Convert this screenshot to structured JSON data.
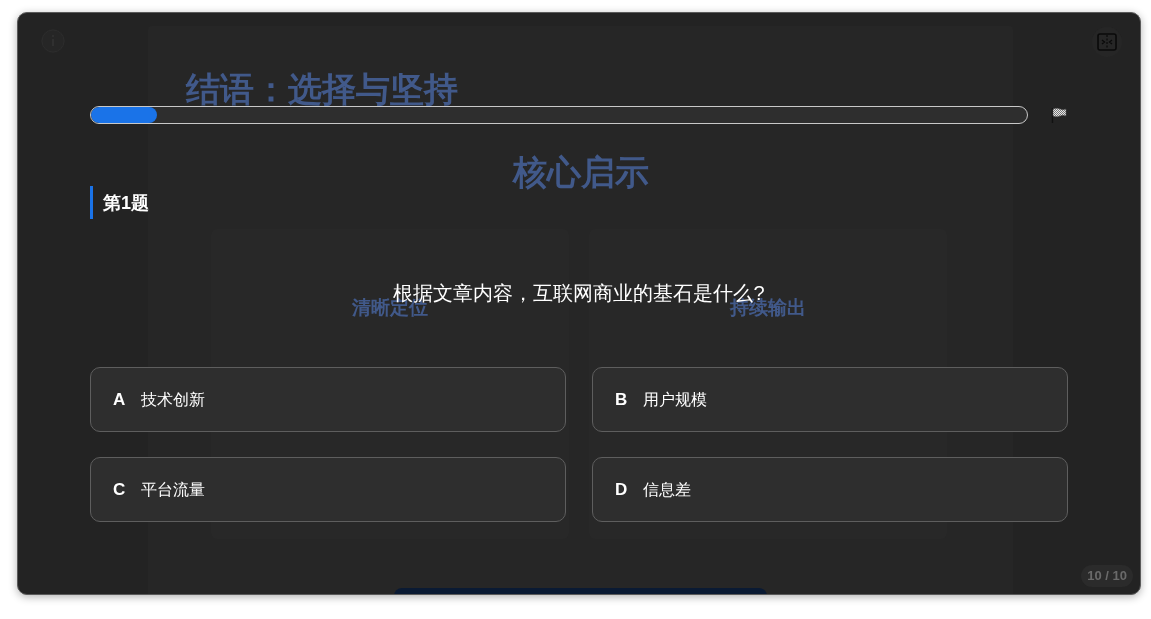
{
  "background_slide": {
    "title": "结语：选择与坚持",
    "heading": "核心启示",
    "cards": [
      "清晰定位",
      "持续输出"
    ],
    "page_counter": "10 / 10"
  },
  "progress": {
    "level": 0.07
  },
  "question": {
    "label": "第1题",
    "text": "根据文章内容，互联网商业的基石是什么?"
  },
  "options": [
    {
      "letter": "A",
      "text": "技术创新",
      "selected": false
    },
    {
      "letter": "B",
      "text": "用户规模",
      "selected": false
    },
    {
      "letter": "C",
      "text": "平台流量",
      "selected": false
    },
    {
      "letter": "D",
      "text": "信息差",
      "selected": false
    }
  ]
}
